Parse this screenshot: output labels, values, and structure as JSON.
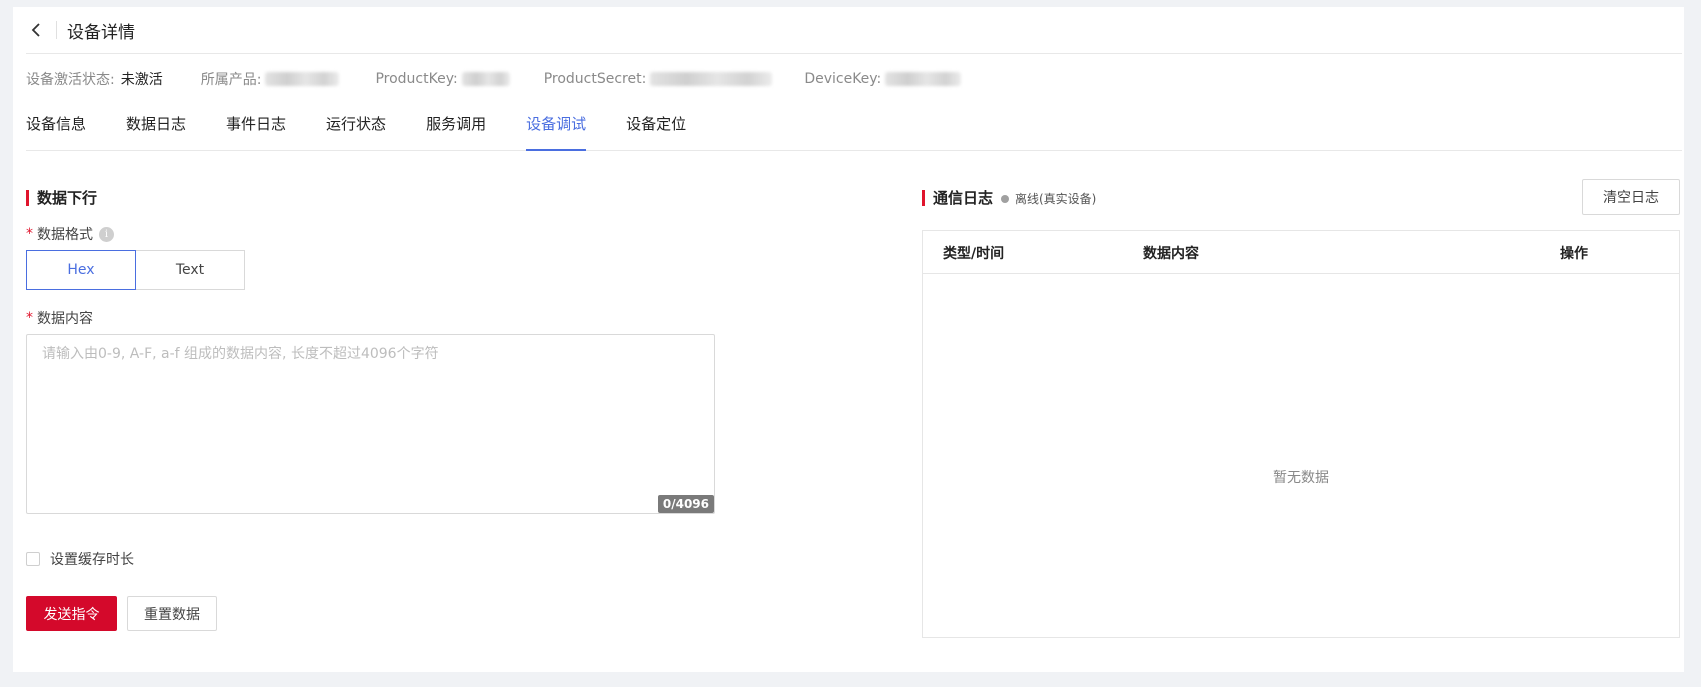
{
  "header": {
    "title": "设备详情",
    "back_icon": "chevron-left-icon"
  },
  "meta": {
    "activation_label": "设备激活状态:",
    "activation_value": "未激活",
    "product_label": "所属产品:",
    "product_key_label": "ProductKey:",
    "product_secret_label": "ProductSecret:",
    "device_key_label": "DeviceKey:"
  },
  "tabs": [
    {
      "label": "设备信息"
    },
    {
      "label": "数据日志"
    },
    {
      "label": "事件日志"
    },
    {
      "label": "运行状态"
    },
    {
      "label": "服务调用"
    },
    {
      "label": "设备调试",
      "active": true
    },
    {
      "label": "设备定位"
    }
  ],
  "downlink": {
    "title": "数据下行",
    "format_label": "数据格式",
    "format_options": [
      "Hex",
      "Text"
    ],
    "format_selected": "Hex",
    "content_label": "数据内容",
    "content_placeholder": "请输入由0-9, A-F, a-f 组成的数据内容, 长度不超过4096个字符",
    "content_value": "",
    "counter": "0/4096",
    "cache_label": "设置缓存时长",
    "cache_checked": false,
    "send_button": "发送指令",
    "reset_button": "重置数据"
  },
  "log": {
    "title": "通信日志",
    "status": "离线(真实设备)",
    "clear_button": "清空日志",
    "columns": [
      "类型/时间",
      "数据内容",
      "操作"
    ],
    "empty_text": "暂无数据"
  },
  "colors": {
    "accent": "#4a6ee0",
    "brand_red": "#d4092b",
    "status_offline": "#a0a0a0"
  }
}
